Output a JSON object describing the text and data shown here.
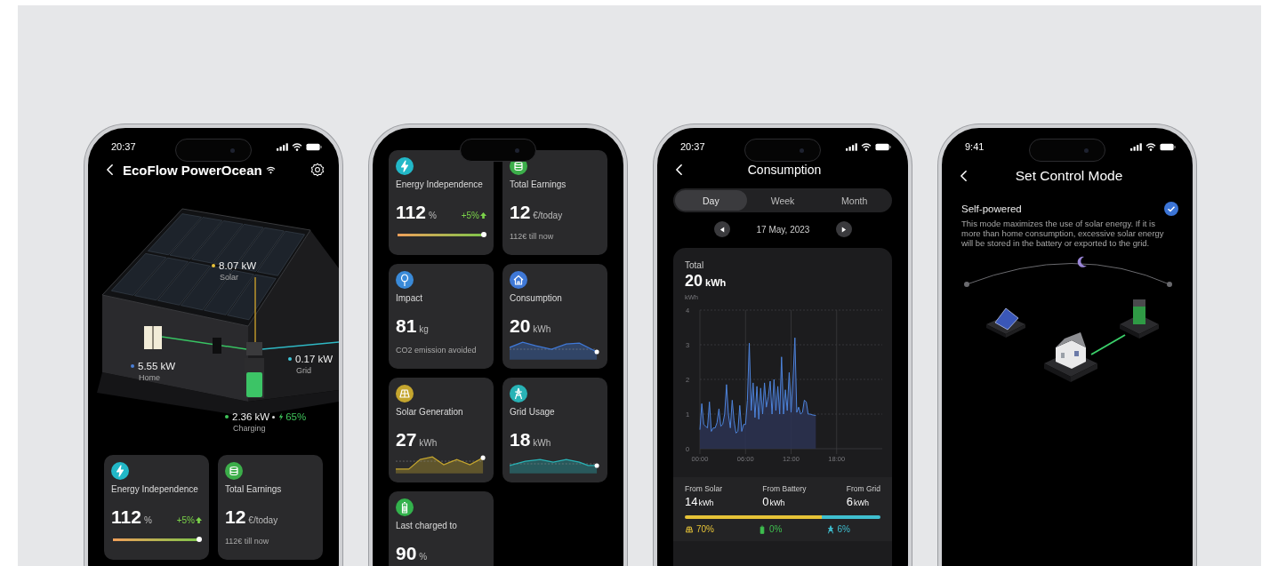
{
  "phones": [
    {
      "kind": "home",
      "status": {
        "time": "20:37"
      },
      "header": {
        "title": "EcoFlow PowerOcean"
      },
      "flows": [
        {
          "value": "8.07 kW",
          "label": "Solar",
          "color": "#e8c23a"
        },
        {
          "value": "5.55 kW",
          "label": "Home",
          "color": "#4a7fd6"
        },
        {
          "value": "0.17 kW",
          "label": "Grid",
          "color": "#3fc6d8"
        },
        {
          "value": "2.36 kW",
          "label": "Charging",
          "color": "#3fc45a",
          "charge": "65%"
        }
      ],
      "cards": [
        {
          "kind": "progress",
          "title": "Energy Independence",
          "value": "112",
          "unit": "%",
          "delta": "+5%",
          "level": 1,
          "color": "#22b8c8"
        },
        {
          "kind": "note",
          "title": "Total Earnings",
          "value": "12",
          "unit": "€/today",
          "note": "112€ till now",
          "color": "#3cae4a"
        }
      ]
    },
    {
      "kind": "cards",
      "cards": [
        {
          "kind": "progress",
          "title": "Energy Independence",
          "value": "112",
          "unit": "%",
          "delta": "+5%",
          "level": 1,
          "color": "#22b8c8"
        },
        {
          "kind": "note",
          "title": "Total Earnings",
          "value": "12",
          "unit": "€/today",
          "note": "112€ till now",
          "color": "#3cae4a"
        },
        {
          "kind": "note",
          "title": "Impact",
          "value": "81",
          "unit": "kg",
          "note": "CO2 emission avoided",
          "color": "#3a8ad8"
        },
        {
          "kind": "sparkline",
          "title": "Consumption",
          "value": "20",
          "unit": "kWh",
          "color": "#3f78d6"
        },
        {
          "kind": "sparkline",
          "title": "Solar Generation",
          "value": "27",
          "unit": "kWh",
          "color": "#c4a52e"
        },
        {
          "kind": "sparkline",
          "title": "Grid Usage",
          "value": "18",
          "unit": "kWh",
          "color": "#28b3b6"
        },
        {
          "kind": "plain",
          "title": "Last charged to",
          "value": "90",
          "unit": "%",
          "color": "#33b24c"
        }
      ]
    },
    {
      "kind": "consumption",
      "status": {
        "time": "20:37"
      },
      "header": {
        "title": "Consumption"
      },
      "tabs": [
        {
          "label": "Day",
          "selected": true
        },
        {
          "label": "Week",
          "selected": false
        },
        {
          "label": "Month",
          "selected": false
        }
      ],
      "date": "17 May, 2023",
      "total": {
        "label": "Total",
        "value": "20",
        "unit": "kWh"
      },
      "chart_data": {
        "type": "area",
        "grid": true,
        "ylabel": "kWh",
        "xlim": [
          0,
          24
        ],
        "ylim": [
          0,
          4
        ],
        "xticks": [
          {
            "value": 0,
            "label": "00:00"
          },
          {
            "value": 6,
            "label": "06:00"
          },
          {
            "value": 12,
            "label": "12:00"
          },
          {
            "value": 18,
            "label": "18:00"
          }
        ],
        "yticks": [
          0,
          1,
          2,
          3,
          4
        ],
        "x": [
          0,
          0.25,
          0.5,
          0.75,
          1,
          1.25,
          1.5,
          1.75,
          2,
          2.25,
          2.5,
          2.75,
          3,
          3.25,
          3.5,
          3.75,
          4,
          4.25,
          4.5,
          4.75,
          5,
          5.25,
          5.5,
          5.75,
          6,
          6.25,
          6.5,
          6.75,
          7,
          7.25,
          7.5,
          7.75,
          8,
          8.25,
          8.5,
          8.75,
          9,
          9.25,
          9.5,
          9.75,
          10,
          10.25,
          10.5,
          10.75,
          11,
          11.25,
          11.5,
          11.75,
          12,
          12.25,
          12.5,
          12.75,
          13,
          13.25,
          13.5,
          13.75,
          14,
          14.25,
          14.5,
          14.75,
          15,
          15.25
        ],
        "values": [
          0.55,
          1.3,
          0.7,
          0.65,
          0.6,
          1.35,
          0.5,
          0.6,
          0.6,
          0.75,
          1.15,
          0.65,
          0.7,
          1.0,
          1.85,
          1.0,
          0.6,
          1.4,
          0.8,
          0.45,
          0.5,
          1.25,
          0.5,
          0.7,
          0.7,
          1.4,
          3.05,
          1.1,
          1.9,
          0.9,
          1.8,
          0.85,
          1.75,
          1.0,
          1.9,
          1.2,
          1.5,
          1.95,
          1.0,
          2.0,
          1.1,
          1.8,
          1.0,
          2.65,
          1.0,
          1.7,
          1.1,
          2.2,
          1.05,
          1.95,
          3.2,
          1.05,
          1.2,
          1.0,
          1.05,
          1.4,
          1.35,
          1.0,
          1.0,
          0.98,
          0.97,
          0.96
        ]
      },
      "sources": [
        {
          "label": "From Solar",
          "value": "14",
          "unit": "kWh",
          "share": "70%",
          "level": 0.7,
          "color": "#e6c337"
        },
        {
          "label": "From Battery",
          "value": "0",
          "unit": "kWh",
          "share": "0%",
          "color": "#3fbf4f"
        },
        {
          "label": "From Grid",
          "value": "6",
          "unit": "kWh",
          "share": "6%",
          "level": 0.3,
          "color": "#3fbfd0"
        }
      ]
    },
    {
      "kind": "mode",
      "status": {
        "time": "9:41"
      },
      "header": {
        "title": "Set Control Mode"
      },
      "options": [
        {
          "title": "Self-powered",
          "description": "This mode maximizes the use of solar energy. If it is more than home consumption, excessive solar energy will be stored in the battery or exported to the grid.",
          "selected": true
        }
      ]
    }
  ]
}
